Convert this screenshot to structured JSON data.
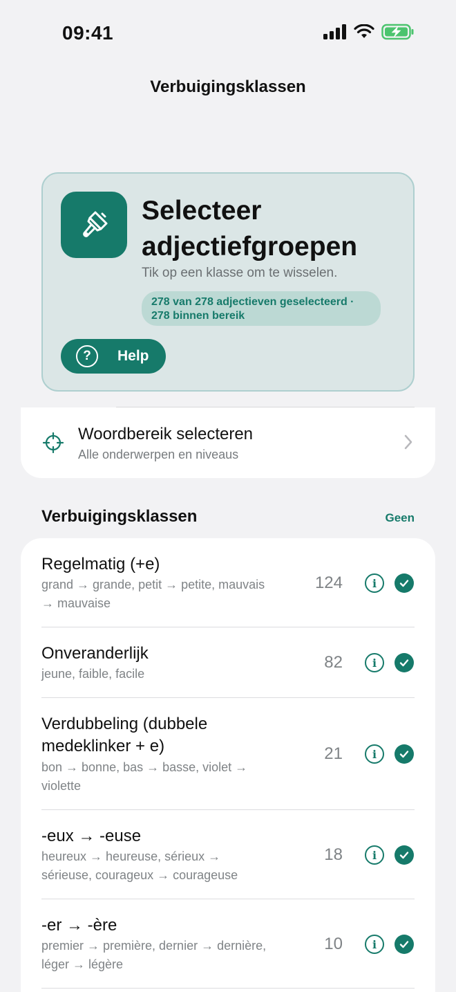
{
  "status_bar": {
    "time": "09:41"
  },
  "nav": {
    "title": "Verbuigingsklassen"
  },
  "hero": {
    "title": "Selecteer adjectiefgroepen",
    "subtitle": "Tik op een klasse om te wisselen.",
    "selection_info": "278 van 278 adjectieven geselecteerd · 278 binnen bereik",
    "help_label": "Help",
    "accent_color": "#167a6a"
  },
  "scope": {
    "title": "Woordbereik selecteren",
    "subtitle": "Alle onderwerpen en niveaus"
  },
  "section": {
    "title": "Verbuigingsklassen",
    "action_label": "Geen"
  },
  "classes": [
    {
      "title": "Regelmatig (+e)",
      "examples": "grand → grande, petit → petite, mauvais → mauvaise",
      "count": "124",
      "selected": true
    },
    {
      "title": "Onveranderlijk",
      "examples": "jeune, faible, facile",
      "count": "82",
      "selected": true
    },
    {
      "title": "Verdubbeling (dubbele medeklinker + e)",
      "examples": "bon → bonne, bas → basse, violet → violette",
      "count": "21",
      "selected": true
    },
    {
      "title": "-eux → -euse",
      "examples": "heureux → heureuse, sérieux → sérieuse, courageux → courageuse",
      "count": "18",
      "selected": true
    },
    {
      "title": "-er → -ère",
      "examples": "premier → première, dernier → dernière, léger → légère",
      "count": "10",
      "selected": true
    }
  ]
}
